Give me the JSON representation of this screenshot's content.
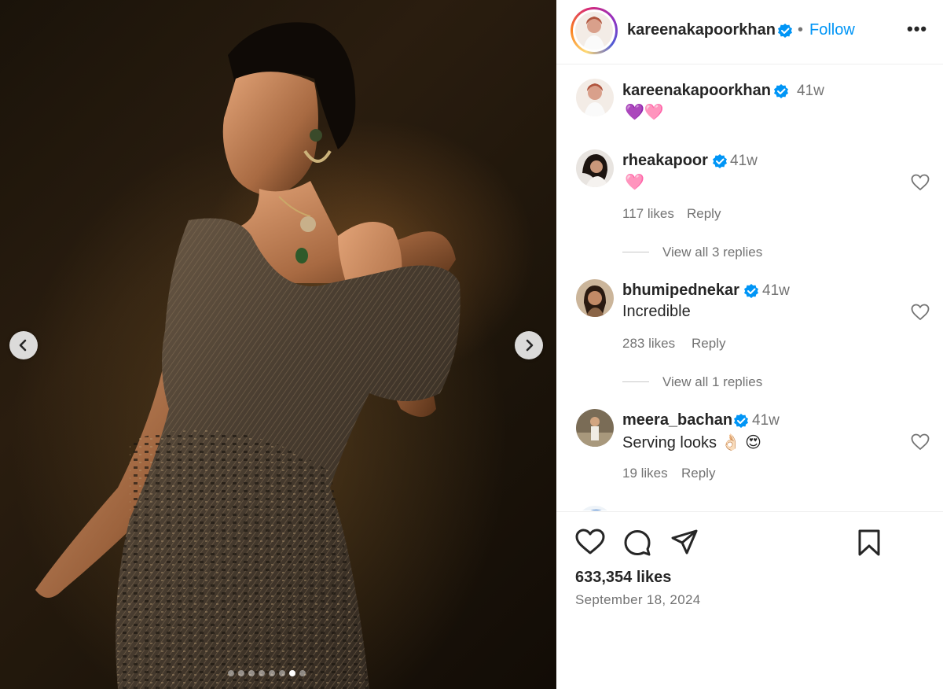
{
  "post": {
    "username": "kareenakapoorkhan",
    "separator": "•",
    "follow_label": "Follow",
    "more_label": "•••",
    "carousel": {
      "total_slides": 8,
      "active_slide": 7
    },
    "caption": {
      "username": "kareenakapoorkhan",
      "time": "41w",
      "text": "💜🩷"
    },
    "comments": [
      {
        "username": "rheakapoor",
        "time": "41w",
        "text": "🩷",
        "likes": "117 likes",
        "reply_label": "Reply",
        "view_replies": "View all 3 replies"
      },
      {
        "username": "bhumipednekar",
        "time": "41w",
        "text": "Incredible",
        "likes": "283 likes",
        "reply_label": "Reply",
        "view_replies": "View all 1 replies"
      },
      {
        "username": "meera_bachan",
        "time": "41w",
        "text": "Serving looks 👌🏻 😍",
        "likes": "19 likes",
        "reply_label": "Reply"
      }
    ],
    "likes": "633,354 likes",
    "date": "September 18, 2024"
  },
  "icons": {
    "verified": "verified-badge-icon",
    "heart": "heart-outline-icon",
    "comment": "comment-bubble-icon",
    "share": "paper-plane-icon",
    "save": "bookmark-icon",
    "prev": "chevron-left-icon",
    "next": "chevron-right-icon"
  },
  "colors": {
    "accent": "#0095f6",
    "text": "#262626",
    "muted": "#737373",
    "border": "#efefef"
  }
}
